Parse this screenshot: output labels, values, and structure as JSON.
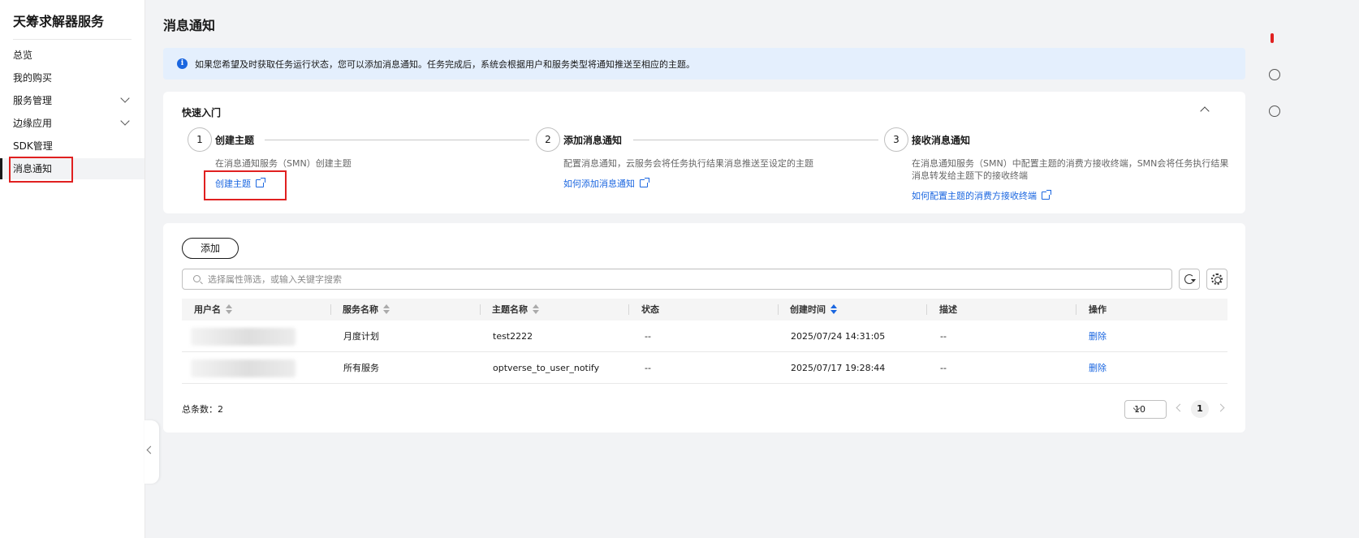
{
  "sidebar": {
    "title": "天筹求解器服务",
    "items": [
      {
        "label": "总览"
      },
      {
        "label": "我的购买"
      },
      {
        "label": "服务管理"
      },
      {
        "label": "边缘应用"
      },
      {
        "label": "SDK管理"
      },
      {
        "label": "消息通知"
      }
    ]
  },
  "page": {
    "title": "消息通知",
    "info_text": "如果您希望及时获取任务运行状态，您可以添加消息通知。任务完成后，系统会根据用户和服务类型将通知推送至相应的主题。"
  },
  "quick_start": {
    "title": "快速入门",
    "steps": [
      {
        "num": "1",
        "title": "创建主题",
        "desc": "在消息通知服务（SMN）创建主题",
        "link": "创建主题"
      },
      {
        "num": "2",
        "title": "添加消息通知",
        "desc": "配置消息通知，云服务会将任务执行结果消息推送至设定的主题",
        "link": "如何添加消息通知"
      },
      {
        "num": "3",
        "title": "接收消息通知",
        "desc": "在消息通知服务（SMN）中配置主题的消费方接收终端，SMN会将任务执行结果消息转发给主题下的接收终端",
        "link": "如何配置主题的消费方接收终端"
      }
    ]
  },
  "list": {
    "add_label": "添加",
    "search_placeholder": "选择属性筛选，或输入关键字搜索",
    "columns": [
      "用户名",
      "服务名称",
      "主题名称",
      "状态",
      "创建时间",
      "描述",
      "操作"
    ],
    "rows": [
      {
        "user": "",
        "service": "月度计划",
        "topic": "test2222",
        "status": "--",
        "created": "2025/07/24 14:31:05",
        "desc": "--",
        "action": "删除"
      },
      {
        "user": "",
        "service": "所有服务",
        "topic": "optverse_to_user_notify",
        "status": "--",
        "created": "2025/07/17 19:28:44",
        "desc": "--",
        "action": "删除"
      }
    ],
    "total_label": "总条数：2",
    "page_size": "10",
    "current_page": "1"
  },
  "colors": {
    "accent": "#1a66e0",
    "highlight": "#e02020",
    "info_bg": "#e4effd"
  }
}
